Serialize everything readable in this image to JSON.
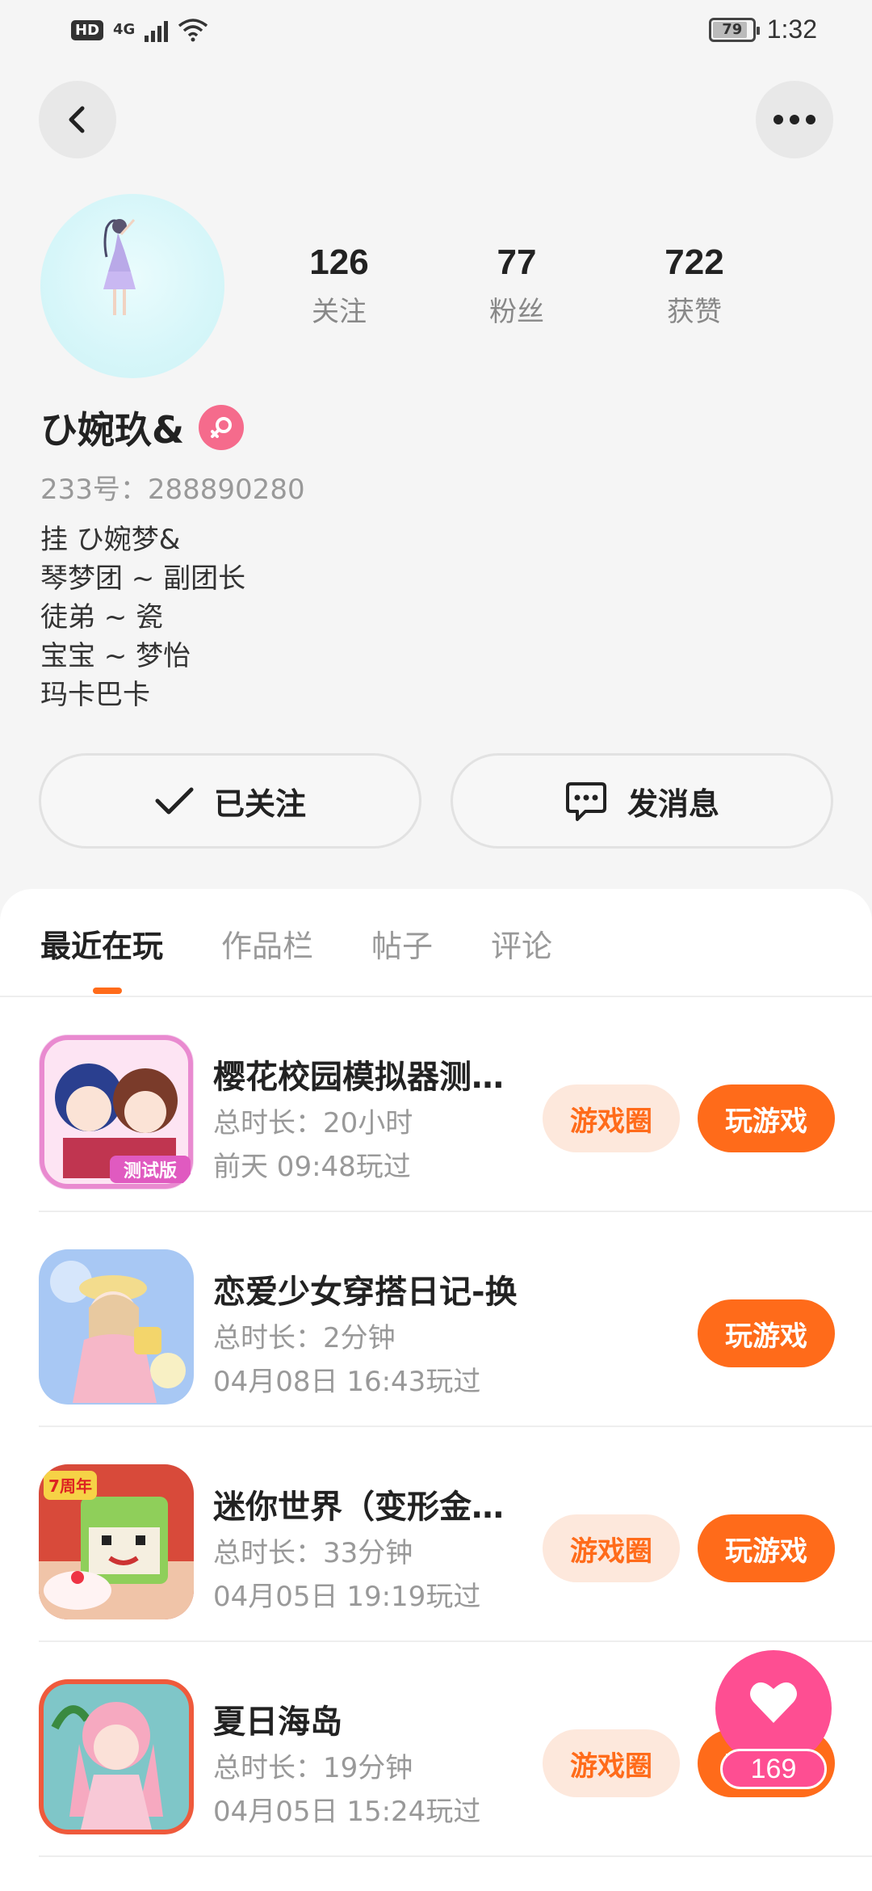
{
  "status_bar": {
    "hd": "HD",
    "network": "4G",
    "battery": "79",
    "time": "1:32"
  },
  "profile": {
    "stats": [
      {
        "value": "126",
        "label": "关注"
      },
      {
        "value": "77",
        "label": "粉丝"
      },
      {
        "value": "722",
        "label": "获赞"
      }
    ],
    "nickname": "ひ婉玖&",
    "user_id": "233号：288890280",
    "bio": [
      "挂 ひ婉梦&",
      "琴梦团 ~ 副团长",
      "徒弟 ~ 瓷",
      "宝宝 ~ 梦怡",
      "玛卡巴卡"
    ]
  },
  "actions": {
    "follow_label": "已关注",
    "message_label": "发消息"
  },
  "tabs": [
    "最近在玩",
    "作品栏",
    "帖子",
    "评论"
  ],
  "games": [
    {
      "title": "樱花校园模拟器测…",
      "duration": "总时长：20小时",
      "last_played": "前天 09:48玩过",
      "circle_label": "游戏圈",
      "play_label": "玩游戏",
      "icon_badge": "测试版"
    },
    {
      "title": "恋爱少女穿搭日记-换",
      "duration": "总时长：2分钟",
      "last_played": "04月08日 16:43玩过",
      "play_label": "玩游戏"
    },
    {
      "title": "迷你世界（变形金…",
      "duration": "总时长：33分钟",
      "last_played": "04月05日 19:19玩过",
      "circle_label": "游戏圈",
      "play_label": "玩游戏",
      "icon_badge": "7周年"
    },
    {
      "title": "夏日海岛",
      "duration": "总时长：19分钟",
      "last_played": "04月05日 15:24玩过",
      "circle_label": "游戏圈",
      "play_label": "玩游戏"
    }
  ],
  "like": {
    "count": "169"
  },
  "colors": {
    "accent": "#ff6b1a",
    "accent_light": "#fde8dc",
    "like_pink": "#fe4e92",
    "gender_pink": "#f56b8c"
  }
}
